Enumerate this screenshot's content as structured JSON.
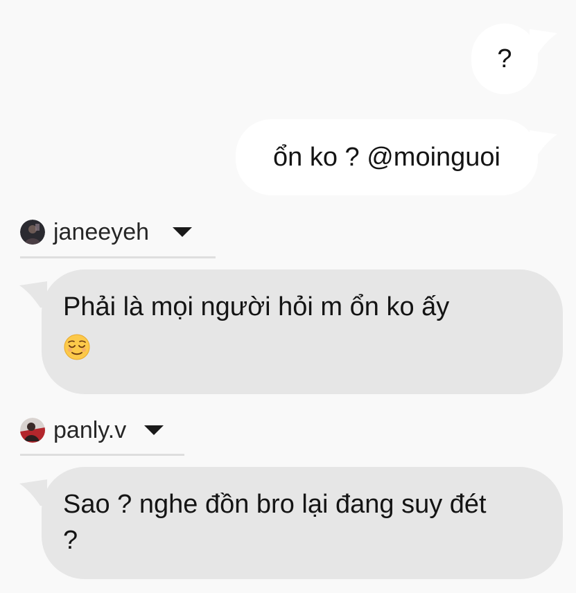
{
  "messages": {
    "out_1": {
      "text": "?"
    },
    "out_2": {
      "text": "ổn ko ? @moinguoi"
    },
    "in_1": {
      "sender": "janeeyeh",
      "text": "Phải là mọi người hỏi m ổn ko ấy",
      "emoji": "relieved-face-emoji"
    },
    "in_2": {
      "sender": "panly.v",
      "text": "Sao ? nghe đồn bro lại đang suy đét ?"
    }
  },
  "icons": {
    "sender_menu": "chevron-down-icon",
    "avatar": "avatar"
  },
  "colors": {
    "background": "#f9f9f9",
    "outgoing_bubble": "#ffffff",
    "incoming_bubble": "#e6e6e6",
    "text": "#141414",
    "divider": "#dedede"
  }
}
